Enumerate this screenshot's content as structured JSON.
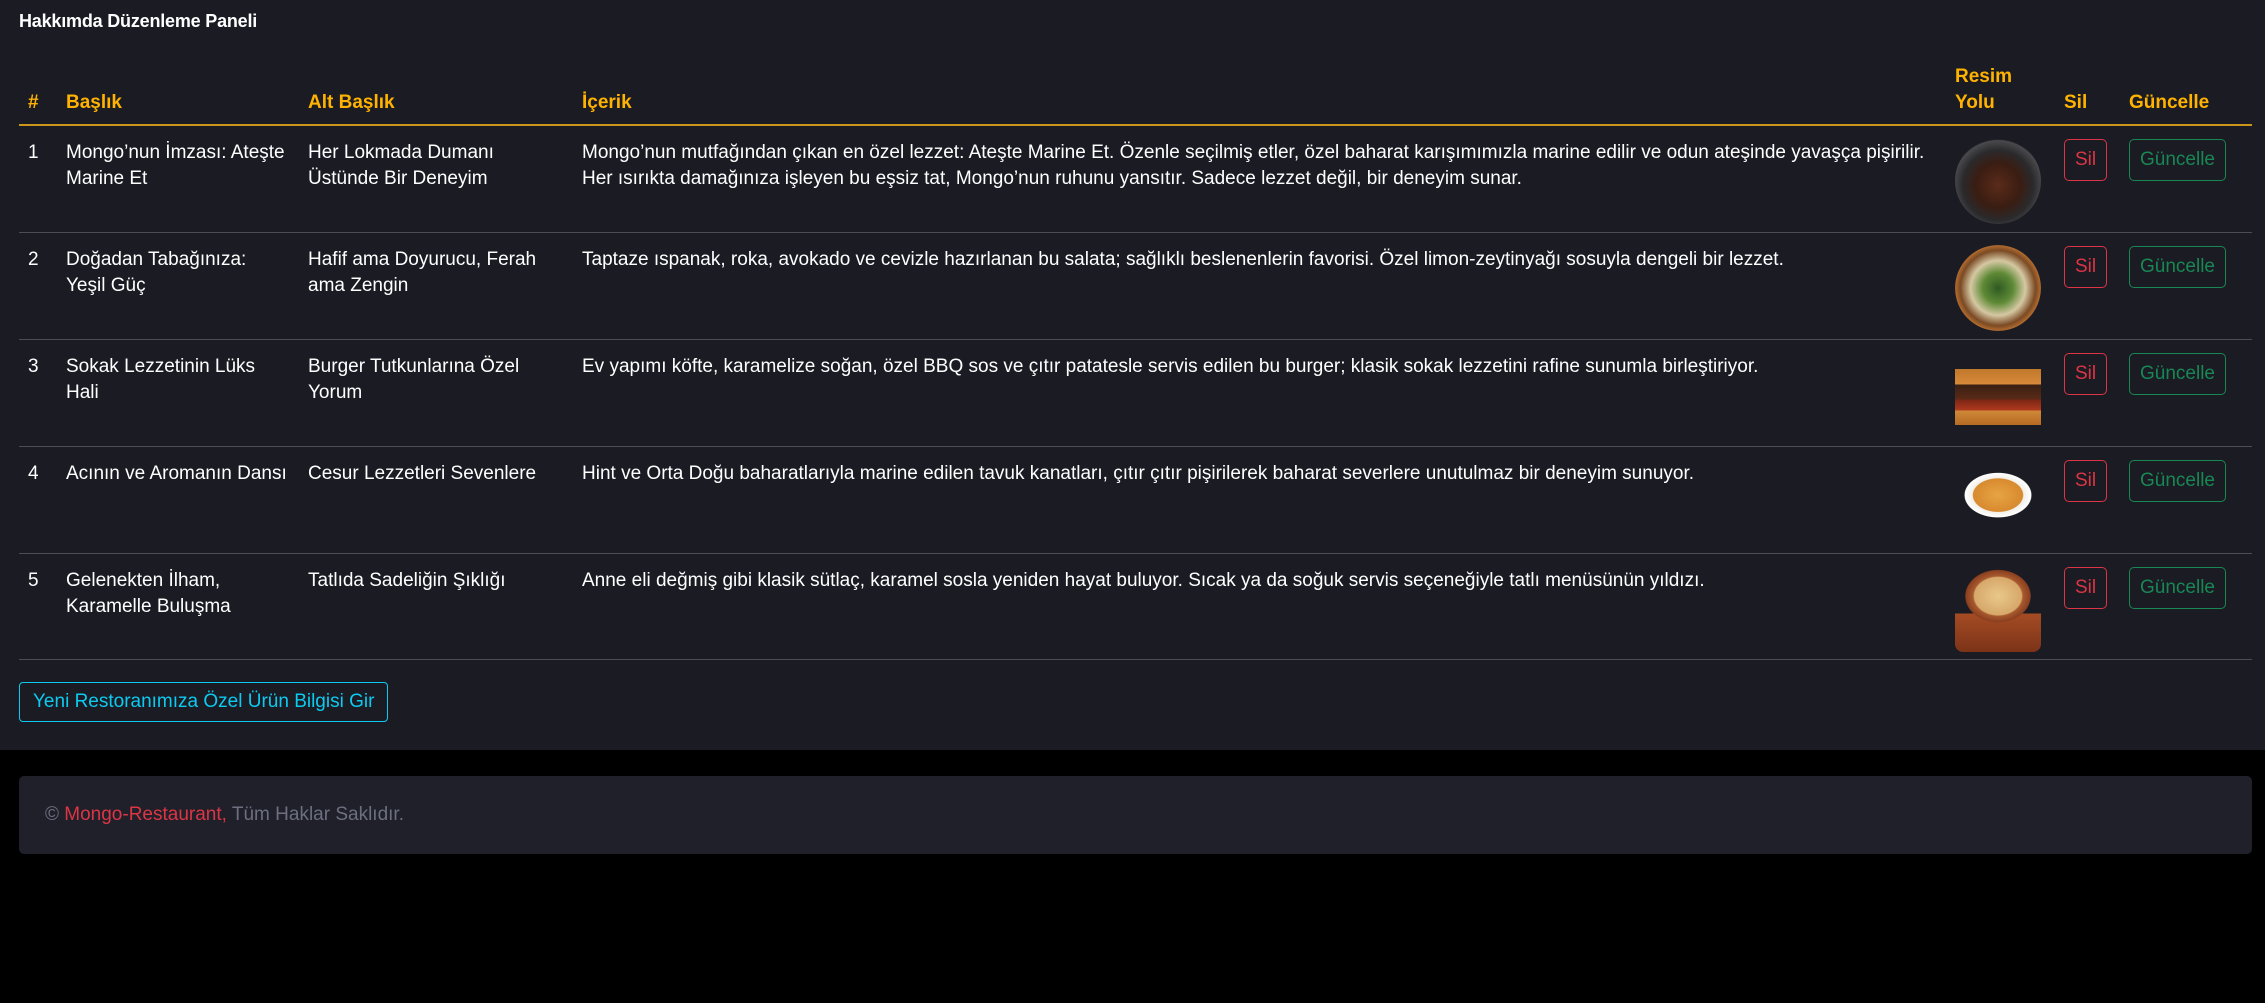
{
  "panel": {
    "title": "Hakkımda Düzenleme Paneli"
  },
  "table": {
    "headers": {
      "num": "#",
      "title": "Başlık",
      "subtitle": "Alt Başlık",
      "content": "İçerik",
      "image": "Resim Yolu",
      "delete": "Sil",
      "update": "Güncelle"
    },
    "rows": [
      {
        "num": "1",
        "title": "Mongo’nun İmzası: Ateşte Marine Et",
        "subtitle": "Her Lokmada Dumanı Üstünde Bir Deneyim",
        "content": "Mongo’nun mutfağından çıkan en özel lezzet: Ateşte Marine Et. Özenle seçilmiş etler, özel baharat karışımımızla marine edilir ve odun ateşinde yavaşça pişirilir. Her ısırıkta damağınıza işleyen bu eşsiz tat, Mongo’nun ruhunu yansıtır. Sadece lezzet değil, bir deneyim sunar.",
        "image": "grilled-steak-photo",
        "delete_label": "Sil",
        "update_label": "Güncelle"
      },
      {
        "num": "2",
        "title": "Doğadan Tabağınıza: Yeşil Güç",
        "subtitle": "Hafif ama Doyurucu, Ferah ama Zengin",
        "content": "Taptaze ıspanak, roka, avokado ve cevizle hazırlanan bu salata; sağlıklı beslenenlerin favorisi. Özel limon-zeytinyağı sosuyla dengeli bir lezzet.",
        "image": "green-salad-photo",
        "delete_label": "Sil",
        "update_label": "Güncelle"
      },
      {
        "num": "3",
        "title": "Sokak Lezzetinin Lüks Hali",
        "subtitle": "Burger Tutkunlarına Özel Yorum",
        "content": "Ev yapımı köfte, karamelize soğan, özel BBQ sos ve çıtır patatesle servis edilen bu burger; klasik sokak lezzetini rafine sunumla birleştiriyor.",
        "image": "burger-photo",
        "delete_label": "Sil",
        "update_label": "Güncelle"
      },
      {
        "num": "4",
        "title": "Acının ve Aromanın Dansı",
        "subtitle": "Cesur Lezzetleri Sevenlere",
        "content": "Hint ve Orta Doğu baharatlarıyla marine edilen tavuk kanatları, çıtır çıtır pişirilerek baharat severlere unutulmaz bir deneyim sunuyor.",
        "image": "soup-bowl-photo",
        "delete_label": "Sil",
        "update_label": "Güncelle"
      },
      {
        "num": "5",
        "title": "Gelenekten İlham, Karamelle Buluşma",
        "subtitle": "Tatlıda Sadeliğin Şıklığı",
        "content": "Anne eli değmiş gibi klasik sütlaç, karamel sosla yeniden hayat buluyor. Sıcak ya da soğuk servis seçeneğiyle tatlı menüsünün yıldızı.",
        "image": "rice-pudding-photo",
        "delete_label": "Sil",
        "update_label": "Güncelle"
      }
    ]
  },
  "new_button_label": "Yeni Restoranımıza Özel Ürün Bilgisi Gir",
  "footer": {
    "copyright_symbol": "©",
    "brand": "Mongo-Restaurant,",
    "rights": "Tüm Haklar Saklıdır."
  },
  "colors": {
    "panel_bg": "#1a1b23",
    "header_text": "#ffb300",
    "delete": "#dc3545",
    "update": "#198754",
    "new_button": "#0dcaf0",
    "footer_bg": "#1f2029"
  }
}
